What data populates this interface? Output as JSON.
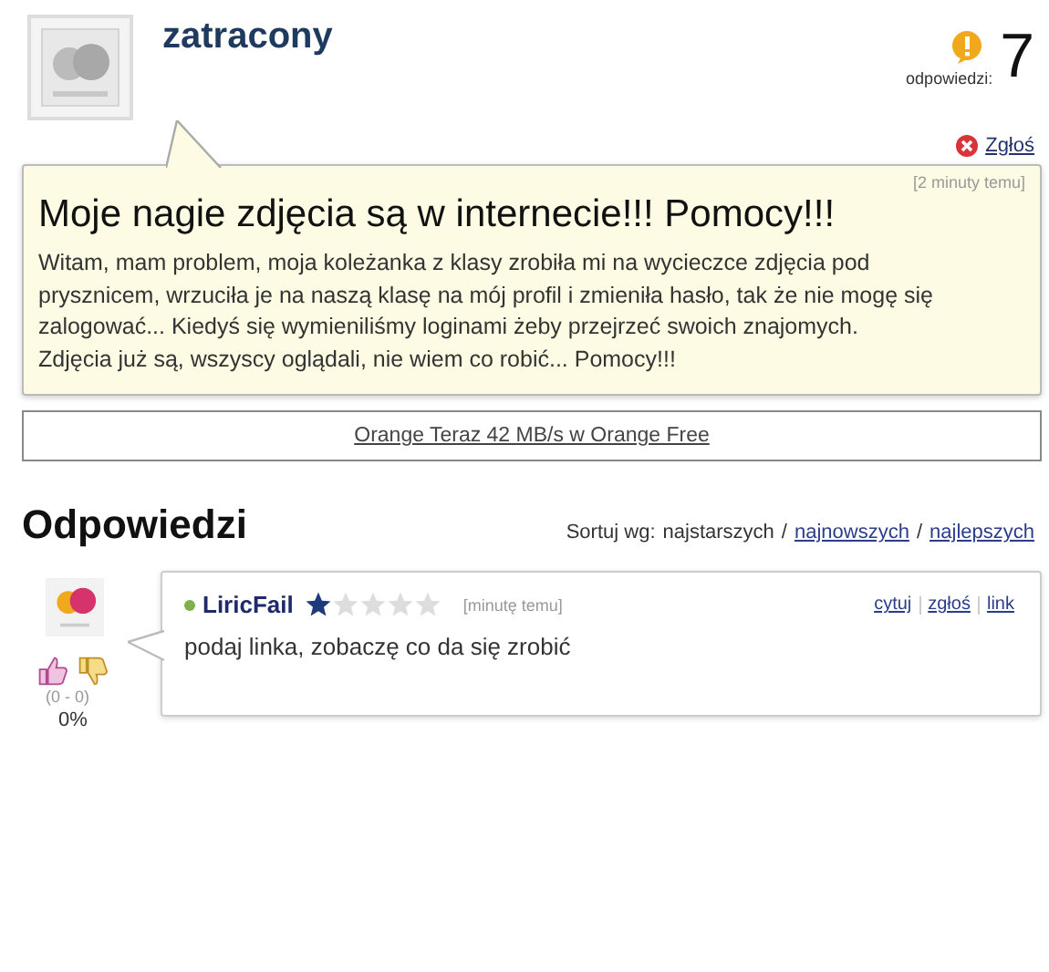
{
  "question": {
    "author": "zatracony",
    "answers_label": "odpowiedzi:",
    "answers_count": "7",
    "report": "Zgłoś",
    "time": "[2 minuty temu]",
    "title": "Moje nagie zdjęcia są w internecie!!! Pomocy!!!",
    "body": "Witam, mam problem, moja koleżanka z klasy zrobiła mi na wycieczce zdjęcia pod prysznicem, wrzuciła je na naszą klasę na mój profil i zmieniła hasło, tak że nie mogę się zalogować... Kiedyś się wymieniliśmy loginami żeby przejrzeć swoich znajomych. Zdjęcia już są, wszyscy oglądali, nie wiem co robić... Pomocy!!!"
  },
  "ad": "Orange Teraz 42 MB/s w Orange Free",
  "answers_section": {
    "title": "Odpowiedzi",
    "sort_label": "Sortuj wg:",
    "separator": "/",
    "sort_options": [
      {
        "label": "najstarszych",
        "selected": true
      },
      {
        "label": "najnowszych",
        "selected": false
      },
      {
        "label": "najlepszych",
        "selected": false
      }
    ]
  },
  "answers": [
    {
      "author": "LiricFail",
      "online": true,
      "stars": 1,
      "time": "[minutę temu]",
      "actions": [
        "cytuj",
        "zgłoś",
        "link"
      ],
      "text": "podaj linka, zobaczę co da się zrobić",
      "votes": "(0 - 0)",
      "percent": "0%"
    }
  ]
}
